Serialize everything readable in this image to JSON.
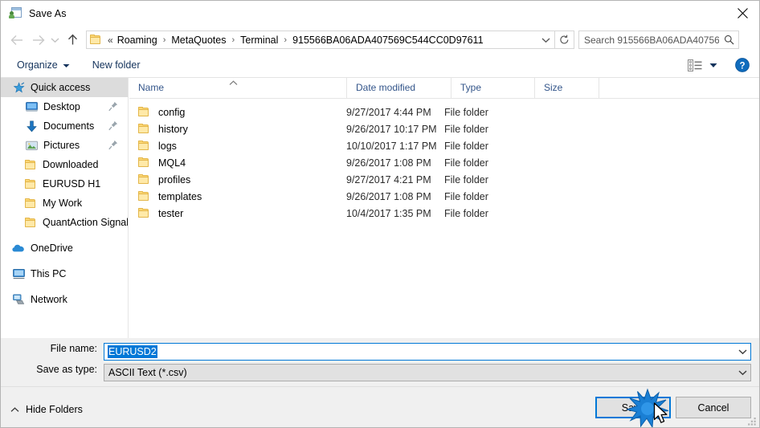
{
  "window": {
    "title": "Save As",
    "icon": "save-as-icon",
    "close_label": "✕"
  },
  "nav": {
    "back_icon": "back-arrow-icon",
    "forward_icon": "forward-arrow-icon",
    "recent_icon": "chevron-down-icon",
    "up_icon": "up-arrow-icon",
    "refresh_icon": "refresh-icon",
    "dropdown_icon": "chevron-down-icon"
  },
  "address": {
    "folder_icon": "folder-icon",
    "overflow": "«",
    "crumbs": [
      "Roaming",
      "MetaQuotes",
      "Terminal",
      "915566BA06ADA407569C544CC0D97611"
    ],
    "separator": "›"
  },
  "search": {
    "placeholder": "Search 915566BA06ADA40756...",
    "value": "",
    "icon": "search-icon"
  },
  "toolbar": {
    "organize_label": "Organize",
    "new_folder_label": "New folder",
    "view_icon": "list-view-icon",
    "view_caret_icon": "chevron-down-icon",
    "help_icon": "help-icon",
    "help_label": "?"
  },
  "sidebar": {
    "items": [
      {
        "label": "Quick access",
        "icon": "star-pin-icon",
        "indent": 0,
        "selected": true,
        "pinned": false
      },
      {
        "label": "Desktop",
        "icon": "desktop-icon",
        "indent": 1,
        "selected": false,
        "pinned": true
      },
      {
        "label": "Documents",
        "icon": "documents-icon",
        "indent": 1,
        "selected": false,
        "pinned": true
      },
      {
        "label": "Pictures",
        "icon": "pictures-icon",
        "indent": 1,
        "selected": false,
        "pinned": true
      },
      {
        "label": "Downloaded",
        "icon": "folder-icon",
        "indent": 1,
        "selected": false,
        "pinned": false
      },
      {
        "label": "EURUSD H1",
        "icon": "folder-icon",
        "indent": 1,
        "selected": false,
        "pinned": false
      },
      {
        "label": "My Work",
        "icon": "folder-icon",
        "indent": 1,
        "selected": false,
        "pinned": false
      },
      {
        "label": "QuantAction Signal",
        "icon": "folder-icon",
        "indent": 1,
        "selected": false,
        "pinned": false
      },
      {
        "label": "OneDrive",
        "icon": "onedrive-icon",
        "indent": 0,
        "selected": false,
        "pinned": false,
        "gap_before": true
      },
      {
        "label": "This PC",
        "icon": "thispc-icon",
        "indent": 0,
        "selected": false,
        "pinned": false,
        "gap_before": true
      },
      {
        "label": "Network",
        "icon": "network-icon",
        "indent": 0,
        "selected": false,
        "pinned": false,
        "gap_before": true
      }
    ]
  },
  "filelist": {
    "columns": [
      "Name",
      "Date modified",
      "Type",
      "Size"
    ],
    "sort_icon": "sort-ascending-icon",
    "rows": [
      {
        "name": "config",
        "date": "9/27/2017 4:44 PM",
        "type": "File folder",
        "size": "",
        "icon": "folder-icon"
      },
      {
        "name": "history",
        "date": "9/26/2017 10:17 PM",
        "type": "File folder",
        "size": "",
        "icon": "folder-icon"
      },
      {
        "name": "logs",
        "date": "10/10/2017 1:17 PM",
        "type": "File folder",
        "size": "",
        "icon": "folder-icon"
      },
      {
        "name": "MQL4",
        "date": "9/26/2017 1:08 PM",
        "type": "File folder",
        "size": "",
        "icon": "folder-icon"
      },
      {
        "name": "profiles",
        "date": "9/27/2017 4:21 PM",
        "type": "File folder",
        "size": "",
        "icon": "folder-icon"
      },
      {
        "name": "templates",
        "date": "9/26/2017 1:08 PM",
        "type": "File folder",
        "size": "",
        "icon": "folder-icon"
      },
      {
        "name": "tester",
        "date": "10/4/2017 1:35 PM",
        "type": "File folder",
        "size": "",
        "icon": "folder-icon"
      }
    ]
  },
  "form": {
    "file_name_label": "File name:",
    "file_name_value": "EURUSD2",
    "save_as_type_label": "Save as type:",
    "save_as_type_value": "ASCII Text (*.csv)",
    "dropdown_icon": "chevron-down-icon"
  },
  "footer": {
    "hide_folders_label": "Hide Folders",
    "hide_folders_icon": "chevron-up-icon",
    "save_label": "Save",
    "cancel_label": "Cancel",
    "resize_grip_icon": "resize-grip-icon",
    "click_indicator_icon": "click-burst-icon",
    "cursor_icon": "mouse-pointer-icon"
  },
  "colors": {
    "accent": "#0078d7",
    "selection": "#0078d7",
    "chrome": "#f0f0f0",
    "folder": "#fcd775",
    "header_text": "#33558a"
  }
}
